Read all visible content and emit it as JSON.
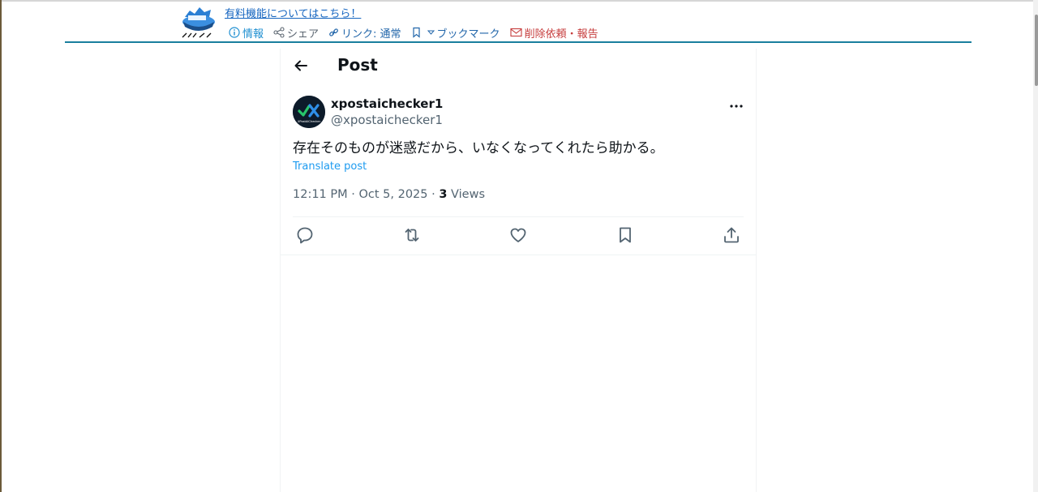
{
  "header": {
    "promo_link": "有料機能についてはこちら！",
    "toolbar": {
      "info_label": "情報",
      "share_label": "シェア",
      "link_label": "リンク: 通常",
      "bookmark_label": "ブックマーク",
      "delete_label": "削除依頼・報告"
    },
    "accent_color": "#1a7f9e"
  },
  "tweet": {
    "page_title": "Post",
    "display_name": "xpostaichecker1",
    "handle": "@xpostaichecker1",
    "text": "存在そのものが迷惑だから、いなくなってくれたら助かる。",
    "translate_label": "Translate post",
    "time": "12:11 PM",
    "date": "Oct 5, 2025",
    "views_count": "3",
    "views_label": "Views",
    "avatar_caption": "XPostAIChecker",
    "icons": [
      "back-arrow-icon",
      "more-icon",
      "reply-icon",
      "retweet-icon",
      "like-icon",
      "bookmark-icon",
      "share-icon"
    ]
  }
}
